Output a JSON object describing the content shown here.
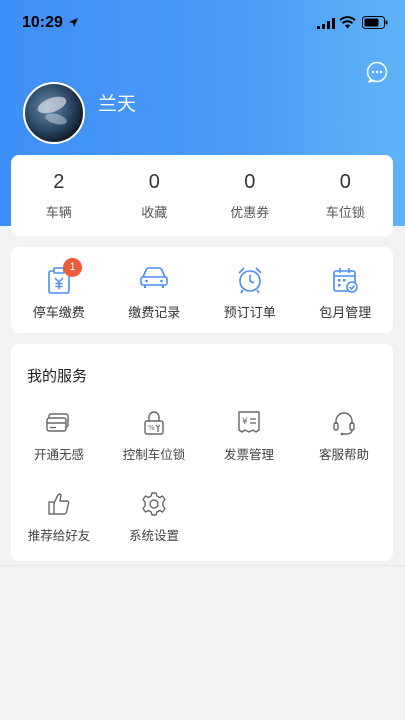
{
  "status_bar": {
    "time": "10:29"
  },
  "profile": {
    "name": "兰天"
  },
  "stats": [
    {
      "value": "2",
      "label": "车辆"
    },
    {
      "value": "0",
      "label": "收藏"
    },
    {
      "value": "0",
      "label": "优惠券"
    },
    {
      "value": "0",
      "label": "车位锁"
    }
  ],
  "quick_actions": [
    {
      "label": "停车缴费",
      "icon": "parking-payment-icon",
      "badge": "1"
    },
    {
      "label": "缴费记录",
      "icon": "car-icon"
    },
    {
      "label": "预订订单",
      "icon": "alarm-clock-icon"
    },
    {
      "label": "包月管理",
      "icon": "calendar-check-icon"
    }
  ],
  "services": {
    "title": "我的服务",
    "items": [
      {
        "label": "开通无感",
        "icon": "card-icon"
      },
      {
        "label": "控制车位锁",
        "icon": "lock-icon"
      },
      {
        "label": "发票管理",
        "icon": "invoice-icon"
      },
      {
        "label": "客服帮助",
        "icon": "headset-icon"
      },
      {
        "label": "推荐给好友",
        "icon": "thumbs-up-icon"
      },
      {
        "label": "系统设置",
        "icon": "settings-icon"
      }
    ]
  },
  "colors": {
    "header_gradient_start": "#3e8ef7",
    "header_gradient_end": "#5fb3f7",
    "accent_icon": "#4a8ef0",
    "badge": "#f05a3c"
  }
}
